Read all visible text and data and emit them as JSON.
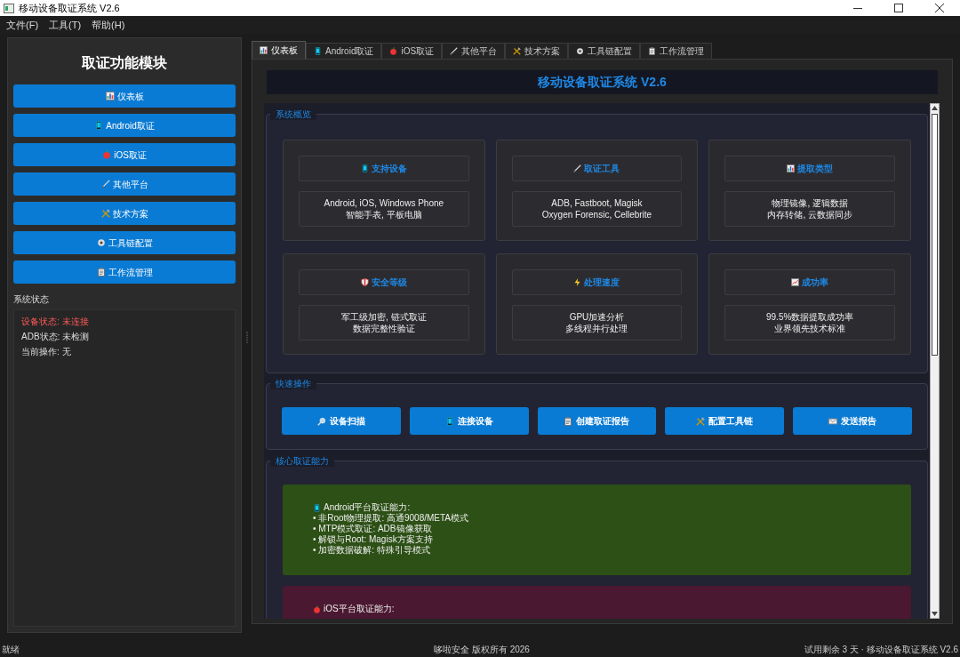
{
  "window": {
    "title": "移动设备取证系统 V2.6"
  },
  "menu": [
    "文件(F)",
    "工具(T)",
    "帮助(H)"
  ],
  "sidebar": {
    "title": "取证功能模块",
    "buttons": [
      "仪表板",
      "Android取证",
      "iOS取证",
      "其他平台",
      "技术方案",
      "工具链配置",
      "工作流管理"
    ],
    "status_title": "系统状态",
    "status_lines": [
      {
        "text": "设备状态: 未连接",
        "kind": "alert"
      },
      {
        "text": "ADB状态: 未检测",
        "kind": "normal"
      },
      {
        "text": "当前操作: 无",
        "kind": "normal"
      }
    ]
  },
  "tabs": [
    {
      "label": "仪表板",
      "selected": true
    },
    {
      "label": "Android取证",
      "selected": false
    },
    {
      "label": "iOS取证",
      "selected": false
    },
    {
      "label": "其他平台",
      "selected": false
    },
    {
      "label": "技术方案",
      "selected": false
    },
    {
      "label": "工具链配置",
      "selected": false
    },
    {
      "label": "工作流管理",
      "selected": false
    }
  ],
  "header": "移动设备取证系统 V2.6",
  "overview": {
    "title": "系统概览",
    "cards": [
      {
        "title": "支持设备",
        "lines": [
          "Android, iOS, Windows Phone",
          "智能手表, 平板电脑"
        ]
      },
      {
        "title": "取证工具",
        "lines": [
          "ADB, Fastboot, Magisk",
          "Oxygen Forensic, Cellebrite"
        ]
      },
      {
        "title": "提取类型",
        "lines": [
          "物理镜像, 逻辑数据",
          "内存转储, 云数据同步"
        ]
      },
      {
        "title": "安全等级",
        "lines": [
          "军工级加密, 链式取证",
          "数据完整性验证"
        ]
      },
      {
        "title": "处理速度",
        "lines": [
          "GPU加速分析",
          "多线程并行处理"
        ]
      },
      {
        "title": "成功率",
        "lines": [
          "99.5%数据提取成功率",
          "业界领先技术标准"
        ]
      }
    ]
  },
  "quick_actions": {
    "title": "快速操作",
    "buttons": [
      "设备扫描",
      "连接设备",
      "创建取证报告",
      "配置工具链",
      "发送报告"
    ]
  },
  "capabilities": {
    "title": "核心取证能力",
    "panels": [
      {
        "kind": "android",
        "heading": "Android平台取证能力:",
        "items": [
          "• 非Root物理提取: 高通9008/META模式",
          "• MTP模式取证: ADB镜像获取",
          "• 解锁与Root: Magisk方案支持",
          "• 加密数据破解: 特殊引导模式"
        ]
      },
      {
        "kind": "ios",
        "heading": "iOS平台取证能力:"
      }
    ]
  },
  "status_bar": {
    "left": "就绪",
    "center": "哆啦安全 版权所有 2026",
    "right": "试用剩余 3 天 · 移动设备取证系统 V2.6"
  }
}
